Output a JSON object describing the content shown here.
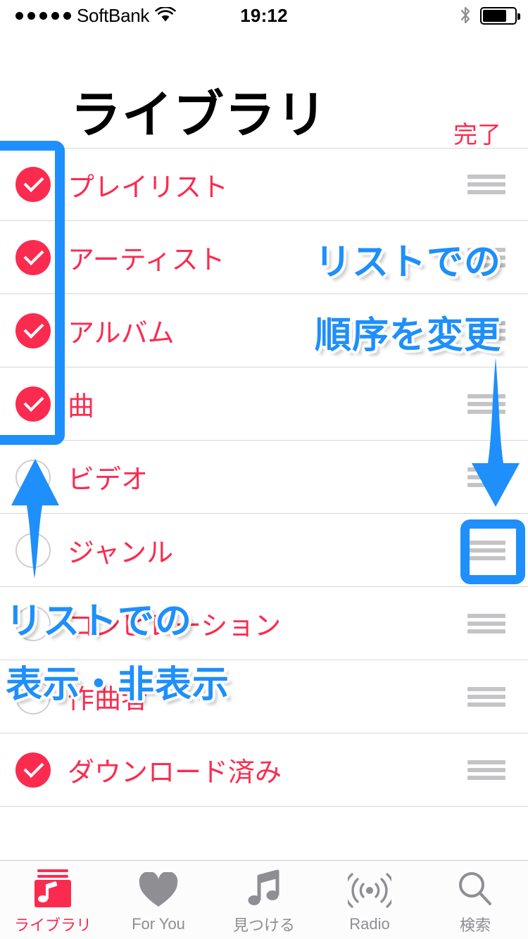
{
  "statusbar": {
    "carrier": "SoftBank",
    "signal_dots": 5,
    "wifi_icon": "wifi-icon",
    "time": "19:12",
    "bluetooth_icon": "bluetooth-icon",
    "battery_icon": "battery-icon",
    "battery_level_pct": 68
  },
  "navbar": {
    "title": "ライブラリ",
    "done_label": "完了",
    "done_color": "#FB2B50"
  },
  "list": {
    "rows": [
      {
        "label": "プレイリスト",
        "checked": true,
        "handle": "drag-handle-icon"
      },
      {
        "label": "アーティスト",
        "checked": true,
        "handle": "drag-handle-icon"
      },
      {
        "label": "アルバム",
        "checked": true,
        "handle": "drag-handle-icon"
      },
      {
        "label": "曲",
        "checked": true,
        "handle": "drag-handle-icon"
      },
      {
        "label": "ビデオ",
        "checked": false,
        "handle": "drag-handle-icon"
      },
      {
        "label": "ジャンル",
        "checked": false,
        "handle": "drag-handle-icon"
      },
      {
        "label": "コンピレーション",
        "checked": false,
        "handle": "drag-handle-icon"
      },
      {
        "label": "作曲者",
        "checked": false,
        "handle": "drag-handle-icon"
      },
      {
        "label": "ダウンロード済み",
        "checked": true,
        "handle": "drag-handle-icon"
      }
    ]
  },
  "annotations": {
    "reorder_line1": "リストでの",
    "reorder_line2": "順序を変更",
    "visibility_line1": "リストでの",
    "visibility_line2": "表示・非表示",
    "color": "#1E8FFB"
  },
  "tabbar": {
    "tabs": [
      {
        "label": "ライブラリ",
        "icon": "library-icon",
        "active": true
      },
      {
        "label": "For You",
        "icon": "heart-icon",
        "active": false
      },
      {
        "label": "見つける",
        "icon": "music-note-icon",
        "active": false
      },
      {
        "label": "Radio",
        "icon": "radio-icon",
        "active": false
      },
      {
        "label": "検索",
        "icon": "search-icon",
        "active": false
      }
    ]
  }
}
